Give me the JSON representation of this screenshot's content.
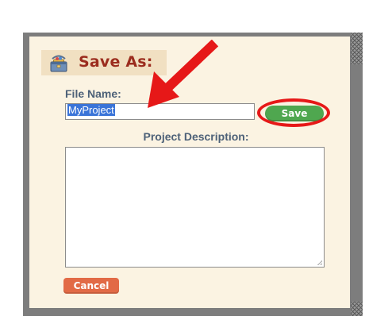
{
  "dialog": {
    "title": "Save As:",
    "icon": "toolbox-icon"
  },
  "file_name": {
    "label": "File Name:",
    "value": "MyProject"
  },
  "save_button": {
    "label": "Save",
    "color": "#4fa74f"
  },
  "description": {
    "label": "Project Description:",
    "value": ""
  },
  "cancel_button": {
    "label": "Cancel",
    "color": "#e26a46"
  },
  "annotations": {
    "arrow_color": "#e61818",
    "ring_color": "#e61818"
  }
}
